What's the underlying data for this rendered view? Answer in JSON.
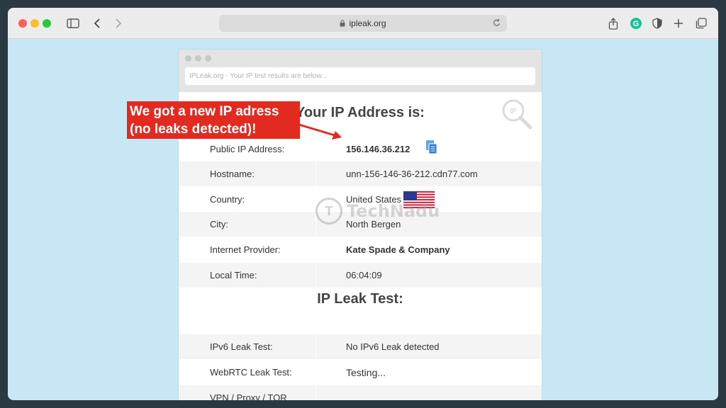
{
  "browser": {
    "url": "ipleak.org",
    "icons": [
      "sidebar-icon",
      "back-icon",
      "forward-icon",
      "lock-icon",
      "reload-icon",
      "share-icon",
      "grammarly-icon",
      "shield-icon",
      "plus-icon",
      "tabs-icon"
    ]
  },
  "page": {
    "search_placeholder": "IPLeak.org - Your IP test results are below...",
    "heading_ip": "Your IP Address is:",
    "heading_leak": "IP Leak Test:",
    "rows": [
      {
        "label": "Public IP Address:",
        "value": "156.146.36.212"
      },
      {
        "label": "Hostname:",
        "value": "unn-156-146-36-212.cdn77.com"
      },
      {
        "label": "Country:",
        "value": "United States"
      },
      {
        "label": "City:",
        "value": "North Bergen"
      },
      {
        "label": "Internet Provider:",
        "value": "Kate Spade & Company"
      },
      {
        "label": "Local Time:",
        "value": "06:04:09"
      }
    ],
    "leak_rows": [
      {
        "label": "IPv6 Leak Test:",
        "value": "No IPv6 Leak detected"
      },
      {
        "label": "WebRTC Leak Test:",
        "value": "Testing..."
      },
      {
        "label": "VPN / Proxy / TOR",
        "value": ""
      }
    ]
  },
  "annotation": {
    "line1": "We got a new IP adress",
    "line2": "(no leaks detected)!",
    "color": "#e22a20"
  },
  "watermark": {
    "logo_letter": "T",
    "text": "TechNadu"
  }
}
